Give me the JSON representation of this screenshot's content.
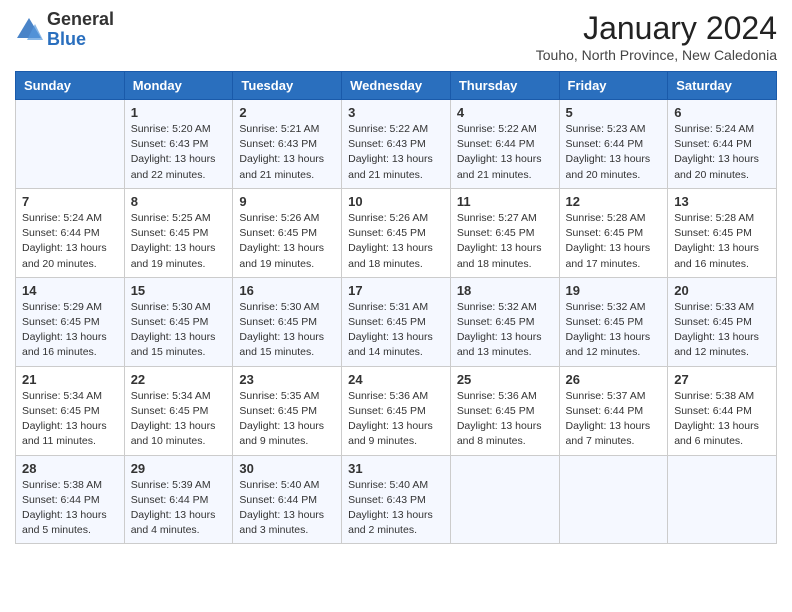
{
  "logo": {
    "general": "General",
    "blue": "Blue"
  },
  "header": {
    "month": "January 2024",
    "location": "Touho, North Province, New Caledonia"
  },
  "weekdays": [
    "Sunday",
    "Monday",
    "Tuesday",
    "Wednesday",
    "Thursday",
    "Friday",
    "Saturday"
  ],
  "weeks": [
    [
      {
        "day": "",
        "info": ""
      },
      {
        "day": "1",
        "info": "Sunrise: 5:20 AM\nSunset: 6:43 PM\nDaylight: 13 hours\nand 22 minutes."
      },
      {
        "day": "2",
        "info": "Sunrise: 5:21 AM\nSunset: 6:43 PM\nDaylight: 13 hours\nand 21 minutes."
      },
      {
        "day": "3",
        "info": "Sunrise: 5:22 AM\nSunset: 6:43 PM\nDaylight: 13 hours\nand 21 minutes."
      },
      {
        "day": "4",
        "info": "Sunrise: 5:22 AM\nSunset: 6:44 PM\nDaylight: 13 hours\nand 21 minutes."
      },
      {
        "day": "5",
        "info": "Sunrise: 5:23 AM\nSunset: 6:44 PM\nDaylight: 13 hours\nand 20 minutes."
      },
      {
        "day": "6",
        "info": "Sunrise: 5:24 AM\nSunset: 6:44 PM\nDaylight: 13 hours\nand 20 minutes."
      }
    ],
    [
      {
        "day": "7",
        "info": "Sunrise: 5:24 AM\nSunset: 6:44 PM\nDaylight: 13 hours\nand 20 minutes."
      },
      {
        "day": "8",
        "info": "Sunrise: 5:25 AM\nSunset: 6:45 PM\nDaylight: 13 hours\nand 19 minutes."
      },
      {
        "day": "9",
        "info": "Sunrise: 5:26 AM\nSunset: 6:45 PM\nDaylight: 13 hours\nand 19 minutes."
      },
      {
        "day": "10",
        "info": "Sunrise: 5:26 AM\nSunset: 6:45 PM\nDaylight: 13 hours\nand 18 minutes."
      },
      {
        "day": "11",
        "info": "Sunrise: 5:27 AM\nSunset: 6:45 PM\nDaylight: 13 hours\nand 18 minutes."
      },
      {
        "day": "12",
        "info": "Sunrise: 5:28 AM\nSunset: 6:45 PM\nDaylight: 13 hours\nand 17 minutes."
      },
      {
        "day": "13",
        "info": "Sunrise: 5:28 AM\nSunset: 6:45 PM\nDaylight: 13 hours\nand 16 minutes."
      }
    ],
    [
      {
        "day": "14",
        "info": "Sunrise: 5:29 AM\nSunset: 6:45 PM\nDaylight: 13 hours\nand 16 minutes."
      },
      {
        "day": "15",
        "info": "Sunrise: 5:30 AM\nSunset: 6:45 PM\nDaylight: 13 hours\nand 15 minutes."
      },
      {
        "day": "16",
        "info": "Sunrise: 5:30 AM\nSunset: 6:45 PM\nDaylight: 13 hours\nand 15 minutes."
      },
      {
        "day": "17",
        "info": "Sunrise: 5:31 AM\nSunset: 6:45 PM\nDaylight: 13 hours\nand 14 minutes."
      },
      {
        "day": "18",
        "info": "Sunrise: 5:32 AM\nSunset: 6:45 PM\nDaylight: 13 hours\nand 13 minutes."
      },
      {
        "day": "19",
        "info": "Sunrise: 5:32 AM\nSunset: 6:45 PM\nDaylight: 13 hours\nand 12 minutes."
      },
      {
        "day": "20",
        "info": "Sunrise: 5:33 AM\nSunset: 6:45 PM\nDaylight: 13 hours\nand 12 minutes."
      }
    ],
    [
      {
        "day": "21",
        "info": "Sunrise: 5:34 AM\nSunset: 6:45 PM\nDaylight: 13 hours\nand 11 minutes."
      },
      {
        "day": "22",
        "info": "Sunrise: 5:34 AM\nSunset: 6:45 PM\nDaylight: 13 hours\nand 10 minutes."
      },
      {
        "day": "23",
        "info": "Sunrise: 5:35 AM\nSunset: 6:45 PM\nDaylight: 13 hours\nand 9 minutes."
      },
      {
        "day": "24",
        "info": "Sunrise: 5:36 AM\nSunset: 6:45 PM\nDaylight: 13 hours\nand 9 minutes."
      },
      {
        "day": "25",
        "info": "Sunrise: 5:36 AM\nSunset: 6:45 PM\nDaylight: 13 hours\nand 8 minutes."
      },
      {
        "day": "26",
        "info": "Sunrise: 5:37 AM\nSunset: 6:44 PM\nDaylight: 13 hours\nand 7 minutes."
      },
      {
        "day": "27",
        "info": "Sunrise: 5:38 AM\nSunset: 6:44 PM\nDaylight: 13 hours\nand 6 minutes."
      }
    ],
    [
      {
        "day": "28",
        "info": "Sunrise: 5:38 AM\nSunset: 6:44 PM\nDaylight: 13 hours\nand 5 minutes."
      },
      {
        "day": "29",
        "info": "Sunrise: 5:39 AM\nSunset: 6:44 PM\nDaylight: 13 hours\nand 4 minutes."
      },
      {
        "day": "30",
        "info": "Sunrise: 5:40 AM\nSunset: 6:44 PM\nDaylight: 13 hours\nand 3 minutes."
      },
      {
        "day": "31",
        "info": "Sunrise: 5:40 AM\nSunset: 6:43 PM\nDaylight: 13 hours\nand 2 minutes."
      },
      {
        "day": "",
        "info": ""
      },
      {
        "day": "",
        "info": ""
      },
      {
        "day": "",
        "info": ""
      }
    ]
  ]
}
